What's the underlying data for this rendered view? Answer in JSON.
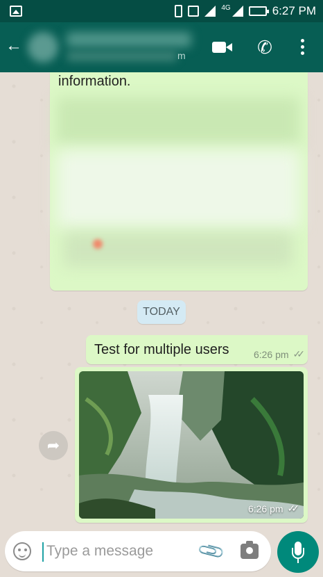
{
  "status_bar": {
    "network_label": "4G",
    "time": "6:27 PM",
    "icons": [
      "image-icon",
      "phone-icon",
      "vibrate-icon",
      "signal-icon",
      "signal-icon",
      "battery-charging-icon"
    ]
  },
  "header": {
    "partial_subtitle_text": "m",
    "icons": [
      "back-arrow-icon",
      "video-call-icon",
      "phone-call-icon",
      "more-vert-icon"
    ]
  },
  "chat": {
    "partial_message_text": "information.",
    "date_divider": "TODAY",
    "text_message": {
      "text": "Test for multiple users",
      "time": "6:26 pm"
    },
    "image_message": {
      "time": "6:26 pm",
      "image_description": "waterfall in forest"
    }
  },
  "composer": {
    "placeholder": "Type a message"
  },
  "colors": {
    "header_bg": "#075e54",
    "status_bar_bg": "#054d44",
    "outgoing_bubble": "#dcf8c6",
    "chat_bg": "#e5ddd5",
    "mic_button": "#00897b",
    "date_badge_bg": "#d4eaf4"
  }
}
